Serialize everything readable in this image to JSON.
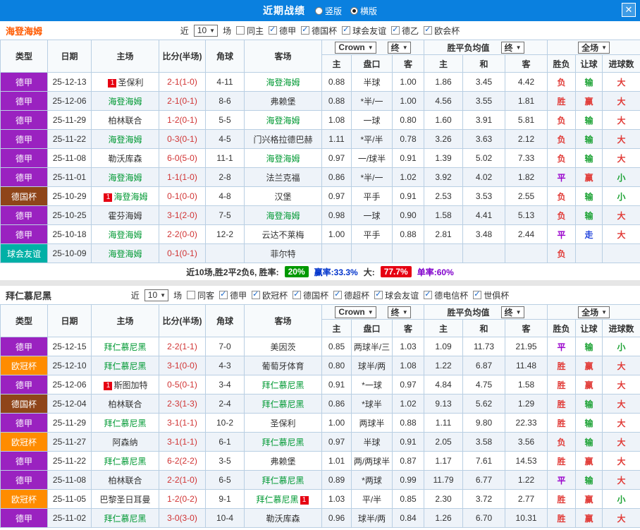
{
  "header": {
    "title": "近期战绩",
    "layout_options": [
      {
        "label": "竖版",
        "selected": false
      },
      {
        "label": "横版",
        "selected": true
      }
    ]
  },
  "icons": {
    "close": "✕",
    "dropdown_arrow": "▼"
  },
  "colors": {
    "topbar": "#0a80df",
    "league": {
      "德甲": "#9a22c0",
      "德国杯": "#8f4519",
      "球会友谊": "#00b0a6",
      "欧冠杯": "#ff8c00"
    },
    "result": {
      "red": "#e13b37",
      "green": "#1ca234",
      "purple": "#9900cc",
      "blue": "#2244dd"
    },
    "focus_team": "#009933",
    "score": "#d03333",
    "badge1_bg": "#e60012",
    "win_rate_badge": "#009900",
    "big_rate_badge": "#e60012",
    "win_text": "#0033cc",
    "single_text": "#8000cc"
  },
  "sections": [
    {
      "team": "海登海姆",
      "team_color": "#ff5a00",
      "filter": {
        "near_label": "近",
        "count": "10",
        "matches_label": "场",
        "checkboxes": [
          {
            "label": "同主",
            "checked": false
          },
          {
            "label": "德甲",
            "checked": true
          },
          {
            "label": "德国杯",
            "checked": true
          },
          {
            "label": "球会友谊",
            "checked": true
          },
          {
            "label": "德乙",
            "checked": true
          },
          {
            "label": "欧会杯",
            "checked": true
          }
        ]
      },
      "controls": {
        "bookmaker": "Crown",
        "odds_stage": "终",
        "avg_label": "胜平负均值",
        "avg_stage": "终",
        "scope": "全场"
      },
      "columns": [
        "类型",
        "日期",
        "主场",
        "比分(半场)",
        "角球",
        "客场"
      ],
      "odds_subcols": [
        "主",
        "盘口",
        "客"
      ],
      "avg_subcols": [
        "主",
        "和",
        "客"
      ],
      "result_subcols": [
        "胜负",
        "让球",
        "进球数"
      ],
      "rows": [
        {
          "league": "德甲",
          "date": "25-12-13",
          "home": {
            "name": "圣保利",
            "badge": "1"
          },
          "score": "2-1(1-0)",
          "corner": "4-11",
          "away": {
            "name": "海登海姆",
            "focus": true
          },
          "odds": [
            "0.88",
            "半球",
            "1.00"
          ],
          "avg": [
            "1.86",
            "3.45",
            "4.42"
          ],
          "results": [
            [
              "负",
              "red"
            ],
            [
              "输",
              "green"
            ],
            [
              "大",
              "red"
            ]
          ]
        },
        {
          "league": "德甲",
          "date": "25-12-06",
          "home": {
            "name": "海登海姆",
            "focus": true
          },
          "score": "2-1(0-1)",
          "corner": "8-6",
          "away": {
            "name": "弗赖堡"
          },
          "odds": [
            "0.88",
            "*半/一",
            "1.00"
          ],
          "avg": [
            "4.56",
            "3.55",
            "1.81"
          ],
          "results": [
            [
              "胜",
              "red"
            ],
            [
              "赢",
              "red"
            ],
            [
              "大",
              "red"
            ]
          ]
        },
        {
          "league": "德甲",
          "date": "25-11-29",
          "home": {
            "name": "柏林联合"
          },
          "score": "1-2(0-1)",
          "corner": "5-5",
          "away": {
            "name": "海登海姆",
            "focus": true
          },
          "odds": [
            "1.08",
            "一球",
            "0.80"
          ],
          "avg": [
            "1.60",
            "3.91",
            "5.81"
          ],
          "results": [
            [
              "负",
              "red"
            ],
            [
              "输",
              "green"
            ],
            [
              "大",
              "red"
            ]
          ]
        },
        {
          "league": "德甲",
          "date": "25-11-22",
          "home": {
            "name": "海登海姆",
            "focus": true
          },
          "score": "0-3(0-1)",
          "corner": "4-5",
          "away": {
            "name": "门兴格拉德巴赫"
          },
          "odds": [
            "1.11",
            "*平/半",
            "0.78"
          ],
          "avg": [
            "3.26",
            "3.63",
            "2.12"
          ],
          "results": [
            [
              "负",
              "red"
            ],
            [
              "输",
              "green"
            ],
            [
              "大",
              "red"
            ]
          ]
        },
        {
          "league": "德甲",
          "date": "25-11-08",
          "home": {
            "name": "勒沃库森"
          },
          "score": "6-0(5-0)",
          "corner": "11-1",
          "away": {
            "name": "海登海姆",
            "focus": true
          },
          "odds": [
            "0.97",
            "一/球半",
            "0.91"
          ],
          "avg": [
            "1.39",
            "5.02",
            "7.33"
          ],
          "results": [
            [
              "负",
              "red"
            ],
            [
              "输",
              "green"
            ],
            [
              "大",
              "red"
            ]
          ]
        },
        {
          "league": "德甲",
          "date": "25-11-01",
          "home": {
            "name": "海登海姆",
            "focus": true
          },
          "score": "1-1(1-0)",
          "corner": "2-8",
          "away": {
            "name": "法兰克福"
          },
          "odds": [
            "0.86",
            "*半/一",
            "1.02"
          ],
          "avg": [
            "3.92",
            "4.02",
            "1.82"
          ],
          "results": [
            [
              "平",
              "purple"
            ],
            [
              "赢",
              "red"
            ],
            [
              "小",
              "green"
            ]
          ]
        },
        {
          "league": "德国杯",
          "date": "25-10-29",
          "home": {
            "name": "海登海姆",
            "focus": true,
            "badge": "1"
          },
          "score": "0-1(0-0)",
          "corner": "4-8",
          "away": {
            "name": "汉堡"
          },
          "odds": [
            "0.97",
            "平手",
            "0.91"
          ],
          "avg": [
            "2.53",
            "3.53",
            "2.55"
          ],
          "results": [
            [
              "负",
              "red"
            ],
            [
              "输",
              "green"
            ],
            [
              "小",
              "green"
            ]
          ]
        },
        {
          "league": "德甲",
          "date": "25-10-25",
          "home": {
            "name": "霍芬海姆"
          },
          "score": "3-1(2-0)",
          "corner": "7-5",
          "away": {
            "name": "海登海姆",
            "focus": true
          },
          "odds": [
            "0.98",
            "一球",
            "0.90"
          ],
          "avg": [
            "1.58",
            "4.41",
            "5.13"
          ],
          "results": [
            [
              "负",
              "red"
            ],
            [
              "输",
              "green"
            ],
            [
              "大",
              "red"
            ]
          ]
        },
        {
          "league": "德甲",
          "date": "25-10-18",
          "home": {
            "name": "海登海姆",
            "focus": true
          },
          "score": "2-2(0-0)",
          "corner": "12-2",
          "away": {
            "name": "云达不莱梅"
          },
          "odds": [
            "1.00",
            "平手",
            "0.88"
          ],
          "avg": [
            "2.81",
            "3.48",
            "2.44"
          ],
          "results": [
            [
              "平",
              "purple"
            ],
            [
              "走",
              "blue"
            ],
            [
              "大",
              "red"
            ]
          ]
        },
        {
          "league": "球会友谊",
          "date": "25-10-09",
          "home": {
            "name": "海登海姆",
            "focus": true
          },
          "score": "0-1(0-1)",
          "corner": "",
          "away": {
            "name": "菲尔特"
          },
          "odds": [
            "",
            "",
            ""
          ],
          "avg": [
            "",
            "",
            ""
          ],
          "results": [
            [
              "负",
              "red"
            ],
            [
              "",
              ""
            ],
            [
              "",
              ""
            ]
          ]
        }
      ],
      "summary": {
        "prefix": "近10场,胜2平2负6, 胜率:",
        "win_rate": "20%",
        "win_text": "赢率:33.3%",
        "big_label": "大:",
        "big_rate": "77.7%",
        "single_text": "单率:60%"
      }
    },
    {
      "team": "拜仁慕尼黑",
      "team_color": "#333333",
      "filter": {
        "near_label": "近",
        "count": "10",
        "matches_label": "场",
        "checkboxes": [
          {
            "label": "同客",
            "checked": false
          },
          {
            "label": "德甲",
            "checked": true
          },
          {
            "label": "欧冠杯",
            "checked": true
          },
          {
            "label": "德国杯",
            "checked": true
          },
          {
            "label": "德超杯",
            "checked": true
          },
          {
            "label": "球会友谊",
            "checked": true
          },
          {
            "label": "德电信杯",
            "checked": true
          },
          {
            "label": "世俱杯",
            "checked": true
          }
        ]
      },
      "controls": {
        "bookmaker": "Crown",
        "odds_stage": "终",
        "avg_label": "胜平负均值",
        "avg_stage": "终",
        "scope": "全场"
      },
      "columns": [
        "类型",
        "日期",
        "主场",
        "比分(半场)",
        "角球",
        "客场"
      ],
      "odds_subcols": [
        "主",
        "盘口",
        "客"
      ],
      "avg_subcols": [
        "主",
        "和",
        "客"
      ],
      "result_subcols": [
        "胜负",
        "让球",
        "进球数"
      ],
      "rows": [
        {
          "league": "德甲",
          "date": "25-12-15",
          "home": {
            "name": "拜仁慕尼黑",
            "focus": true
          },
          "score": "2-2(1-1)",
          "corner": "7-0",
          "away": {
            "name": "美因茨"
          },
          "odds": [
            "0.85",
            "两球半/三",
            "1.03"
          ],
          "avg": [
            "1.09",
            "11.73",
            "21.95"
          ],
          "results": [
            [
              "平",
              "purple"
            ],
            [
              "输",
              "green"
            ],
            [
              "小",
              "green"
            ]
          ]
        },
        {
          "league": "欧冠杯",
          "date": "25-12-10",
          "home": {
            "name": "拜仁慕尼黑",
            "focus": true
          },
          "score": "3-1(0-0)",
          "corner": "4-3",
          "away": {
            "name": "葡萄牙体育"
          },
          "odds": [
            "0.80",
            "球半/两",
            "1.08"
          ],
          "avg": [
            "1.22",
            "6.87",
            "11.48"
          ],
          "results": [
            [
              "胜",
              "red"
            ],
            [
              "赢",
              "red"
            ],
            [
              "大",
              "red"
            ]
          ]
        },
        {
          "league": "德甲",
          "date": "25-12-06",
          "home": {
            "name": "斯图加特",
            "badge": "1"
          },
          "score": "0-5(0-1)",
          "corner": "3-4",
          "away": {
            "name": "拜仁慕尼黑",
            "focus": true
          },
          "odds": [
            "0.91",
            "*一球",
            "0.97"
          ],
          "avg": [
            "4.84",
            "4.75",
            "1.58"
          ],
          "results": [
            [
              "胜",
              "red"
            ],
            [
              "赢",
              "red"
            ],
            [
              "大",
              "red"
            ]
          ]
        },
        {
          "league": "德国杯",
          "date": "25-12-04",
          "home": {
            "name": "柏林联合"
          },
          "score": "2-3(1-3)",
          "corner": "2-4",
          "away": {
            "name": "拜仁慕尼黑",
            "focus": true
          },
          "odds": [
            "0.86",
            "*球半",
            "1.02"
          ],
          "avg": [
            "9.13",
            "5.62",
            "1.29"
          ],
          "results": [
            [
              "胜",
              "red"
            ],
            [
              "输",
              "green"
            ],
            [
              "大",
              "red"
            ]
          ]
        },
        {
          "league": "德甲",
          "date": "25-11-29",
          "home": {
            "name": "拜仁慕尼黑",
            "focus": true
          },
          "score": "3-1(1-1)",
          "corner": "10-2",
          "away": {
            "name": "圣保利"
          },
          "odds": [
            "1.00",
            "两球半",
            "0.88"
          ],
          "avg": [
            "1.11",
            "9.80",
            "22.33"
          ],
          "results": [
            [
              "胜",
              "red"
            ],
            [
              "输",
              "green"
            ],
            [
              "大",
              "red"
            ]
          ]
        },
        {
          "league": "欧冠杯",
          "date": "25-11-27",
          "home": {
            "name": "阿森纳"
          },
          "score": "3-1(1-1)",
          "corner": "6-1",
          "away": {
            "name": "拜仁慕尼黑",
            "focus": true
          },
          "odds": [
            "0.97",
            "半球",
            "0.91"
          ],
          "avg": [
            "2.05",
            "3.58",
            "3.56"
          ],
          "results": [
            [
              "负",
              "red"
            ],
            [
              "输",
              "green"
            ],
            [
              "大",
              "red"
            ]
          ]
        },
        {
          "league": "德甲",
          "date": "25-11-22",
          "home": {
            "name": "拜仁慕尼黑",
            "focus": true
          },
          "score": "6-2(2-2)",
          "corner": "3-5",
          "away": {
            "name": "弗赖堡"
          },
          "odds": [
            "1.01",
            "两/两球半",
            "0.87"
          ],
          "avg": [
            "1.17",
            "7.61",
            "14.53"
          ],
          "results": [
            [
              "胜",
              "red"
            ],
            [
              "赢",
              "red"
            ],
            [
              "大",
              "red"
            ]
          ]
        },
        {
          "league": "德甲",
          "date": "25-11-08",
          "home": {
            "name": "柏林联合"
          },
          "score": "2-2(1-0)",
          "corner": "6-5",
          "away": {
            "name": "拜仁慕尼黑",
            "focus": true
          },
          "odds": [
            "0.89",
            "*两球",
            "0.99"
          ],
          "avg": [
            "11.79",
            "6.77",
            "1.22"
          ],
          "results": [
            [
              "平",
              "purple"
            ],
            [
              "输",
              "green"
            ],
            [
              "大",
              "red"
            ]
          ]
        },
        {
          "league": "欧冠杯",
          "date": "25-11-05",
          "home": {
            "name": "巴黎圣日耳曼"
          },
          "score": "1-2(0-2)",
          "corner": "9-1",
          "away": {
            "name": "拜仁慕尼黑",
            "focus": true,
            "badge": "1",
            "badge_pos": "after"
          },
          "odds": [
            "1.03",
            "平/半",
            "0.85"
          ],
          "avg": [
            "2.30",
            "3.72",
            "2.77"
          ],
          "results": [
            [
              "胜",
              "red"
            ],
            [
              "赢",
              "red"
            ],
            [
              "小",
              "green"
            ]
          ]
        },
        {
          "league": "德甲",
          "date": "25-11-02",
          "home": {
            "name": "拜仁慕尼黑",
            "focus": true
          },
          "score": "3-0(3-0)",
          "corner": "10-4",
          "away": {
            "name": "勒沃库森"
          },
          "odds": [
            "0.96",
            "球半/两",
            "0.84"
          ],
          "avg": [
            "1.26",
            "6.70",
            "10.31"
          ],
          "results": [
            [
              "胜",
              "red"
            ],
            [
              "赢",
              "red"
            ],
            [
              "大",
              "red"
            ]
          ]
        }
      ]
    }
  ]
}
